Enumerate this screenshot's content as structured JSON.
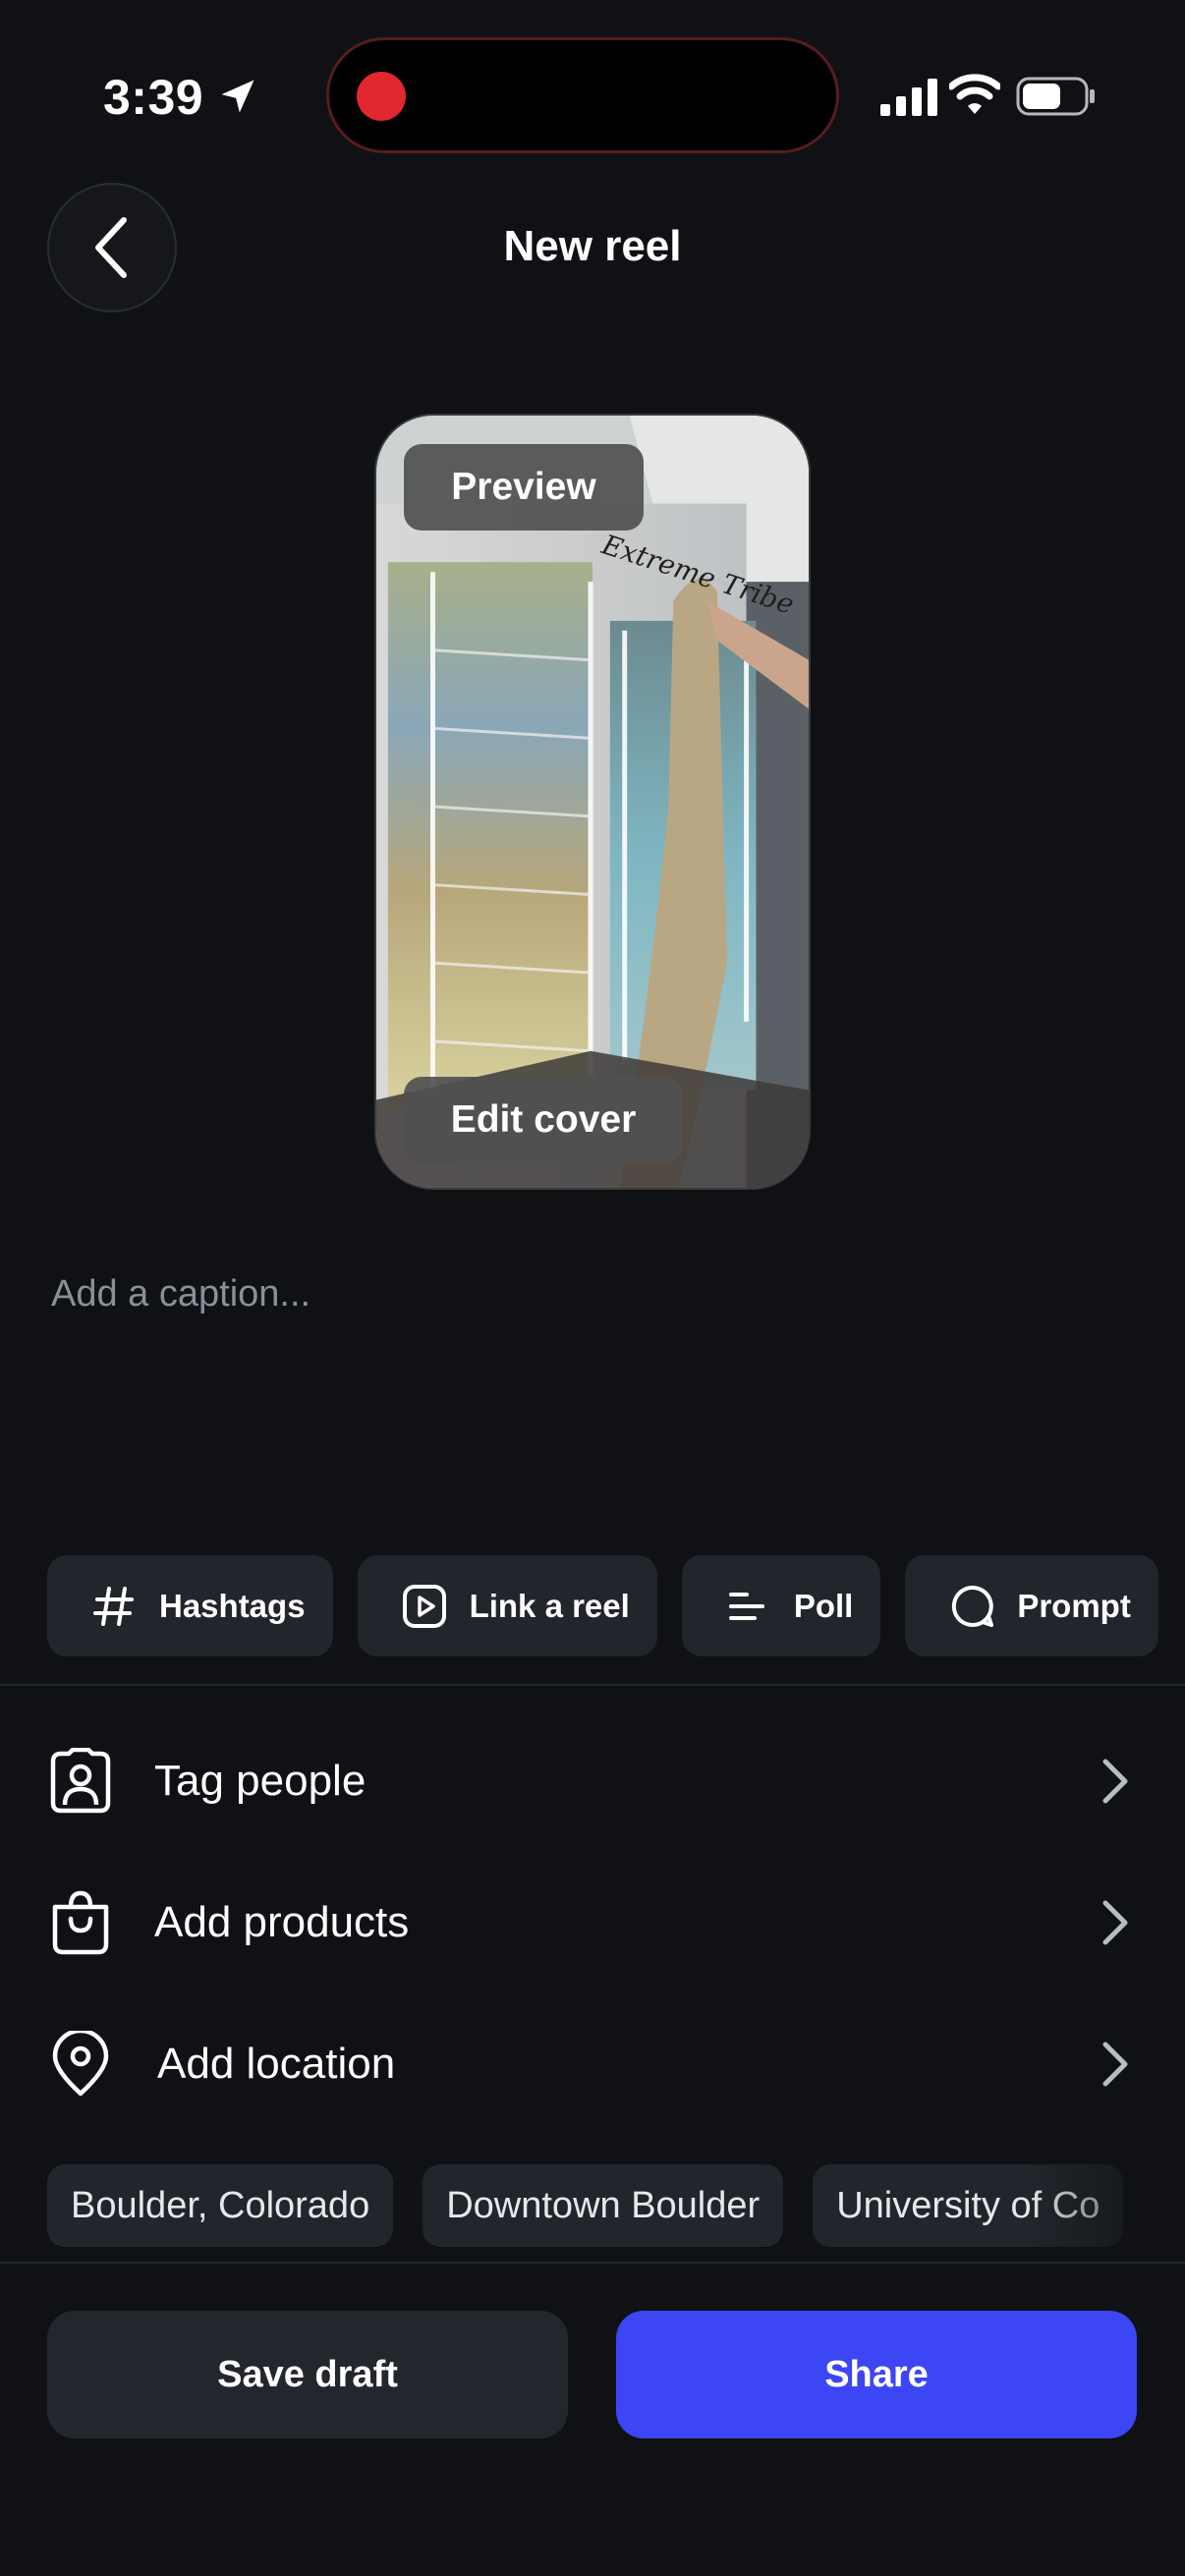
{
  "status_bar": {
    "time": "3:39",
    "icons": [
      "location-arrow-icon",
      "recording-indicator-icon",
      "cellular-signal-icon",
      "wifi-icon",
      "battery-icon"
    ]
  },
  "header": {
    "back_icon": "chevron-left-icon",
    "title": "New reel"
  },
  "preview": {
    "preview_label": "Preview",
    "edit_cover_label": "Edit cover"
  },
  "caption": {
    "placeholder": "Add a caption..."
  },
  "chips": [
    {
      "label": "Hashtags",
      "icon": "hash-icon"
    },
    {
      "label": "Link a reel",
      "icon": "reel-link-icon"
    },
    {
      "label": "Poll",
      "icon": "poll-icon"
    },
    {
      "label": "Prompt",
      "icon": "prompt-bubble-icon"
    }
  ],
  "rows": [
    {
      "label": "Tag people",
      "icon": "tag-person-icon"
    },
    {
      "label": "Add products",
      "icon": "shopping-bag-icon"
    },
    {
      "label": "Add location",
      "icon": "location-pin-icon"
    }
  ],
  "location_suggestions": [
    "Boulder, Colorado",
    "Downtown Boulder",
    "University of Co"
  ],
  "actions": {
    "save_draft": "Save draft",
    "share": "Share"
  },
  "colors": {
    "background": "#0f1115",
    "chip_bg": "#22252b",
    "share_accent": "#3d46f5",
    "record_red": "#e0282e",
    "muted_text": "#8a8f98"
  }
}
